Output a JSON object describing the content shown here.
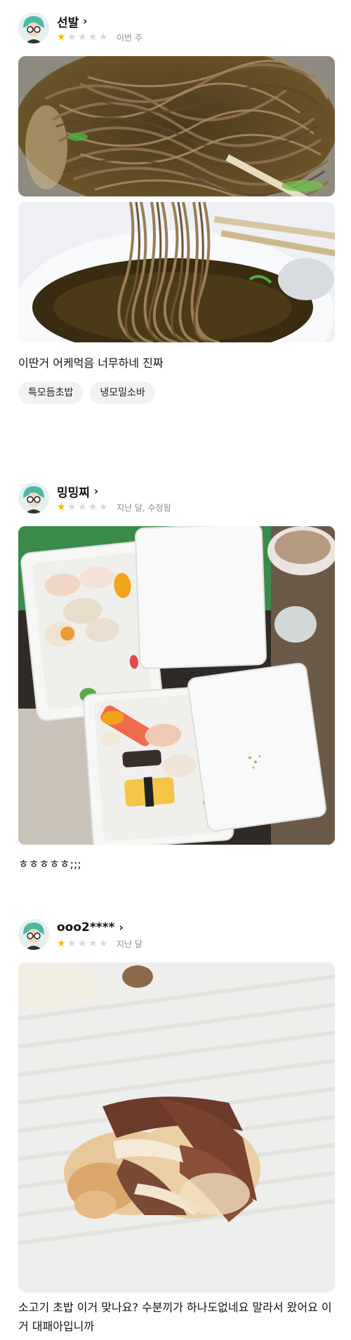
{
  "reviews": [
    {
      "username": "선발",
      "rating": 1,
      "rating_max": 5,
      "date": "이번 주",
      "text": "이딴거 어케먹음 너무하네 진짜",
      "tags": [
        "특모듬초밥",
        "냉모밀소바"
      ]
    },
    {
      "username": "밍밍찌",
      "rating": 1,
      "rating_max": 5,
      "date": "지난 달, 수정됨",
      "text": "ㅎㅎㅎㅎㅎ;;;"
    },
    {
      "username": "ooo2****",
      "rating": 1,
      "rating_max": 5,
      "date": "지난 달",
      "text": "소고기 초밥 이거 맞나요? 수분끼가 하나도없네요 말라서 왔어요 이거 대패아입니까"
    }
  ],
  "icons": {
    "star": "star-icon",
    "chevron": "chevron-right-icon",
    "avatar": "avatar-icon"
  },
  "colors": {
    "star_on": "#f5b800",
    "star_off": "#d6d6d6",
    "chip_bg": "#f2f2f2",
    "meta_text": "#8a8a8a"
  }
}
